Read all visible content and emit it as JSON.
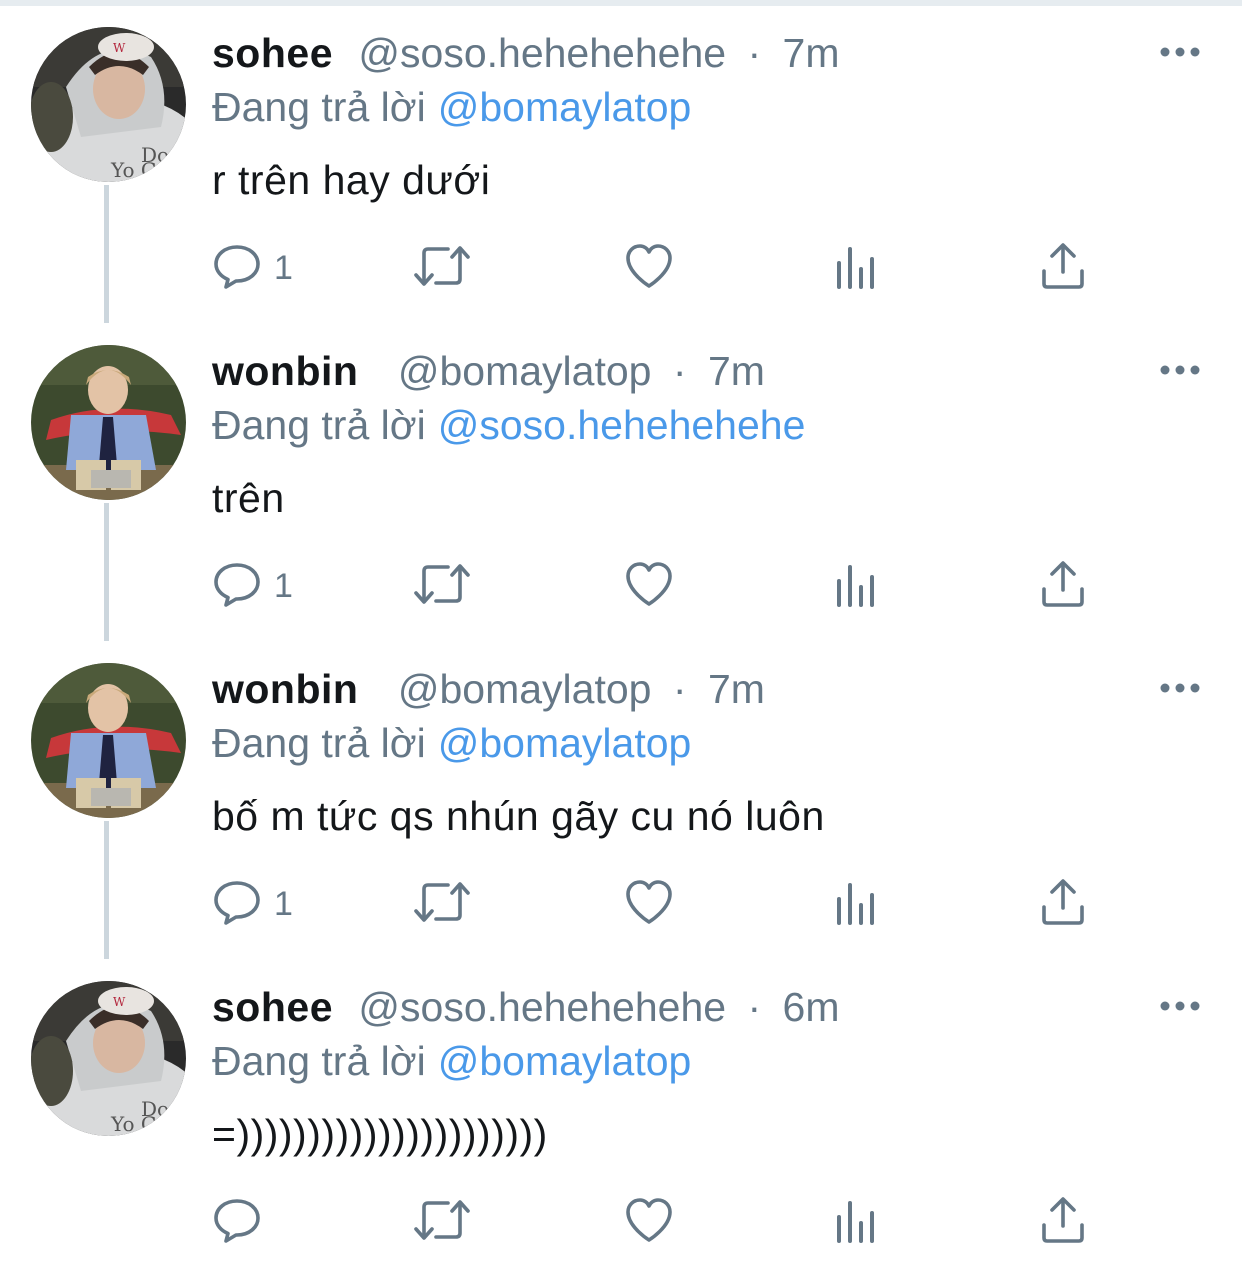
{
  "reply_prefix": "Đang trả lời",
  "separator": "·",
  "tweets": [
    {
      "name": "sohee",
      "handle": "@soso.hehehehehe",
      "time": "7m",
      "reply_to": "@bomaylatop",
      "text": "r trên hay dưới",
      "reply_count": "1",
      "avatar": "sohee-avatar"
    },
    {
      "name": "wonbin",
      "handle": "@bomaylatop",
      "time": "7m",
      "reply_to": "@soso.hehehehehe",
      "text": "trên",
      "reply_count": "1",
      "avatar": "wonbin-avatar"
    },
    {
      "name": "wonbin",
      "handle": "@bomaylatop",
      "time": "7m",
      "reply_to": "@bomaylatop",
      "text": "bố m tức qs nhún gãy cu nó luôn",
      "reply_count": "1",
      "avatar": "wonbin-avatar"
    },
    {
      "name": "sohee",
      "handle": "@soso.hehehehehe",
      "time": "6m",
      "reply_to": "@bomaylatop",
      "text": "=))))))))))))))))))))))",
      "reply_count": "",
      "avatar": "sohee-avatar"
    }
  ],
  "colors": {
    "text_primary": "#14171a",
    "text_secondary": "#657786",
    "link": "#4a99e9",
    "thread_line": "#ccd6dd"
  },
  "icons": {
    "reply": "speech-bubble-icon",
    "retweet": "retweet-arrows-icon",
    "like": "heart-icon",
    "stats": "bar-chart-icon",
    "share": "share-upload-icon",
    "more": "ellipsis-icon"
  }
}
